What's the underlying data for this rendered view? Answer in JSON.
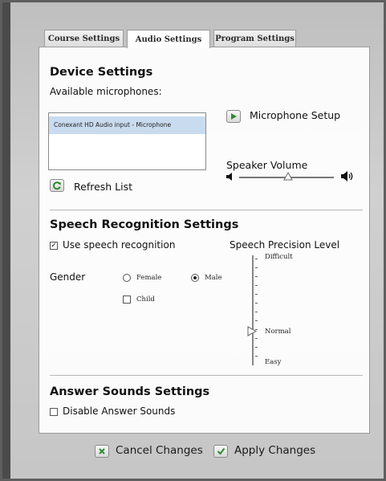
{
  "tabs": [
    {
      "label": "Course Settings"
    },
    {
      "label": "Audio Settings"
    },
    {
      "label": "Program Settings"
    }
  ],
  "device": {
    "heading": "Device Settings",
    "mics_label": "Available microphones:",
    "mic_items": [
      "Conexant HD Audio input - Microphone"
    ],
    "mic_setup_label": "Microphone Setup",
    "refresh_label": "Refresh List",
    "speaker_label": "Speaker Volume",
    "speaker_volume": 0.52
  },
  "speech": {
    "heading": "Speech Recognition Settings",
    "use_label": "Use speech recognition",
    "use_checked": true,
    "gender_label": "Gender",
    "female_label": "Female",
    "male_label": "Male",
    "child_label": "Child",
    "gender_selected": "Male",
    "child_checked": false,
    "precision_label": "Speech Precision Level",
    "level_difficult": "Difficult",
    "level_normal": "Normal",
    "level_easy": "Easy",
    "precision_selected": "Normal"
  },
  "answer": {
    "heading": "Answer Sounds Settings",
    "disable_label": "Disable Answer Sounds",
    "disable_checked": false
  },
  "footer": {
    "cancel_label": "Cancel Changes",
    "apply_label": "Apply Changes"
  },
  "colors": {
    "green_icon": "#2e8b2e",
    "list_selection": "#c9dbef"
  }
}
